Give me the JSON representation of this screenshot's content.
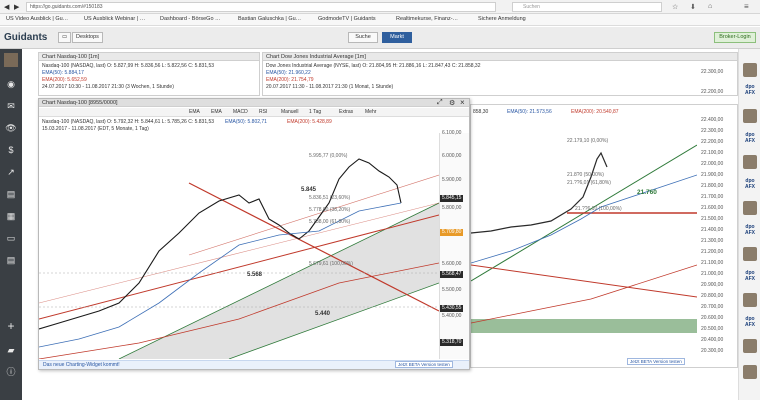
{
  "browser": {
    "url": "https://go.guidants.com/#150183",
    "search_placeholder": "Suchen",
    "bookmarks": [
      "US Video Ausblick | Gu…",
      "US Ausblick Webinar | …",
      "Dashboard - BörseGo …",
      "Bastian Galuschka | Gu…",
      "GodmodeTV | Guidants",
      "Realtimekurse, Finanz-…",
      "Sichere Anmeldung"
    ]
  },
  "app": {
    "logo": "Guidants",
    "tab_desktops": "Desktops",
    "btn_search": "Suche",
    "btn_markt": "Markt",
    "btn_broker": "Broker-Login"
  },
  "top_left": {
    "title": "Chart Nasdaq-100 [1m]",
    "line1": "Nasdaq-100 (NASDAQ, last)  O: 5.827,99  H: 5.836,56  L: 5.822,56  C: 5.831,53",
    "line2": "EMA(50): 5.884,17",
    "line3": "EMA(200): 5.652,59",
    "line4": "24.07.2017 10:30 - 11.08.2017 21:30   (3 Wochen, 1 Stunde)"
  },
  "top_right": {
    "title": "Chart Dow Jones Industrial Average [1m]",
    "line1": "Dow Jones Industrial Average (NYSE, last)  O: 21.804,95  H: 21.886,16  L: 21.847,43  C: 21.858,32",
    "line2": "EMA(50): 21.960,22",
    "line3": "EMA(200): 21.754,79",
    "line4": "20.07.2017 11:30 - 11.08.2017 21:30   (1 Monat, 1 Stunde)",
    "axis": [
      "22.300,00",
      "22.200,00"
    ]
  },
  "main": {
    "title": "Chart Nasdaq-100 [8955/0000]",
    "toolbar": [
      "EMA",
      "EMA",
      "MACD",
      "RSI",
      "Manuell",
      "1 Tag",
      "Extras",
      "Mehr"
    ],
    "legend1": "Nasdaq-100 (NASDAQ, last)  O: 5.792,32  H: 5.844,61  L: 5.785,26  C: 5.831,53",
    "legend_ema50": "EMA(50): 5.802,71",
    "legend_ema200": "EMA(200): 5.428,89",
    "legend2": "15.03.2017 - 11.08.2017   (EDT, 5 Monate, 1 Tag)",
    "axis": [
      "6.100,00",
      "6.000,00",
      "5.900,00",
      "5.800,00",
      "5.600,00",
      "5.500,00",
      "5.400,00"
    ],
    "tags": [
      {
        "label": "5.845,15",
        "color": "#2a2a2a"
      },
      {
        "label": "5.709,80",
        "color": "#e89a28"
      },
      {
        "label": "5.568,47",
        "color": "#2a2a2a"
      },
      {
        "label": "5.430,55",
        "color": "#2a2a2a"
      },
      {
        "label": "5.318,70",
        "color": "#2a2a2a"
      }
    ],
    "annotations": [
      "5.995,77 (0,00%)",
      "5.845",
      "5.836,51 (23,60%)",
      "5.778,60 (38,20%)",
      "5.738,00 (61,80%)",
      "5.679,61 (100,00%)",
      "5.568",
      "5.440"
    ],
    "notice": "Das neue Charting-Widget kommt!",
    "beta": "Jetzt BETA Version testen"
  },
  "dow": {
    "head_values": [
      "858,30",
      "EMA(50): 21.573,56",
      "EMA(200): 20.540,87"
    ],
    "axis": [
      "22.400,00",
      "22.300,00",
      "22.200,00",
      "22.100,00",
      "22.000,00",
      "21.900,00",
      "21.800,00",
      "21.700,00",
      "21.600,00",
      "21.500,00",
      "21.400,00",
      "21.300,00",
      "21.200,00",
      "21.100,00",
      "21.000,00",
      "20.900,00",
      "20.800,00",
      "20.700,00",
      "20.600,00",
      "20.500,00",
      "20.400,00",
      "20.300,00"
    ],
    "annotations": [
      "22.179,10 (0,00%)",
      "21.8?0 (50,00%)",
      "21.??6,01 (61,80%)",
      "21.??6,10 (100,00%)"
    ],
    "big_label": "21.760",
    "beta": "Jetzt BETA Version testen"
  },
  "right_rail": [
    "dpo AFX",
    "dpo AFX",
    "dpo AFX",
    "dpo AFX",
    "dpo AFX",
    "dpo AFX"
  ]
}
